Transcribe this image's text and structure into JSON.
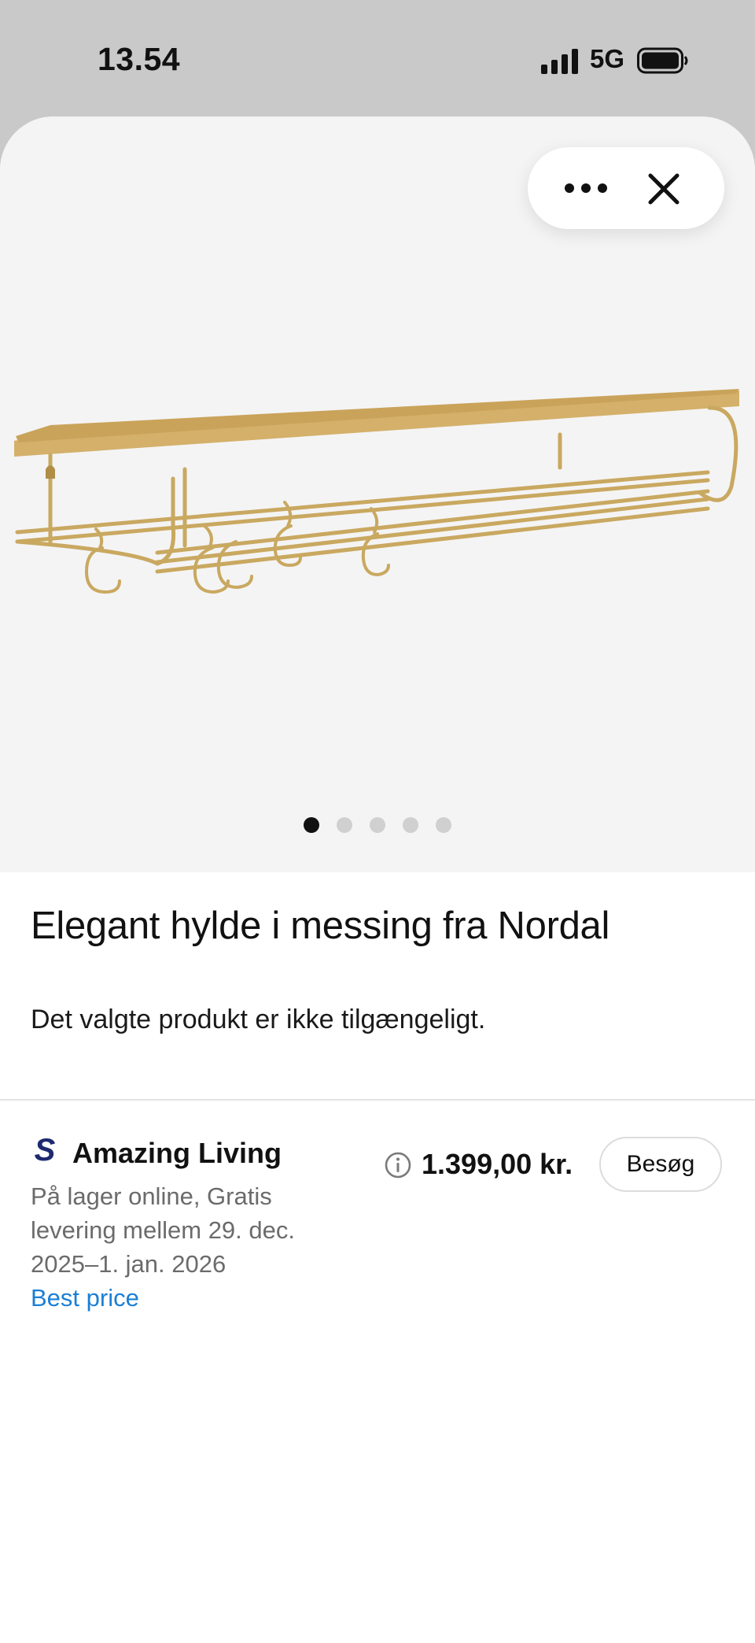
{
  "status_bar": {
    "time": "13.54",
    "network": "5G"
  },
  "product": {
    "title": "Elegant hylde i messing fra Nordal",
    "availability": "Det valgte produkt er ikke tilgængeligt.",
    "gallery": {
      "image_count": 5,
      "active_index": 0
    }
  },
  "offer": {
    "seller": "Amazing Living",
    "seller_logo_letter": "S",
    "description": "På lager online, Gratis levering mellem 29. dec. 2025–1. jan. 2026",
    "badge": "Best price",
    "price": "1.399,00 kr.",
    "visit_label": "Besøg"
  },
  "icons": [
    "signal-icon",
    "battery-icon",
    "more-icon",
    "close-icon",
    "info-icon"
  ],
  "colors": {
    "link": "#1a7fd6",
    "image_bg": "#f4f4f4",
    "brass": "#c9a860",
    "seller_logo": "#1e2a6e"
  }
}
